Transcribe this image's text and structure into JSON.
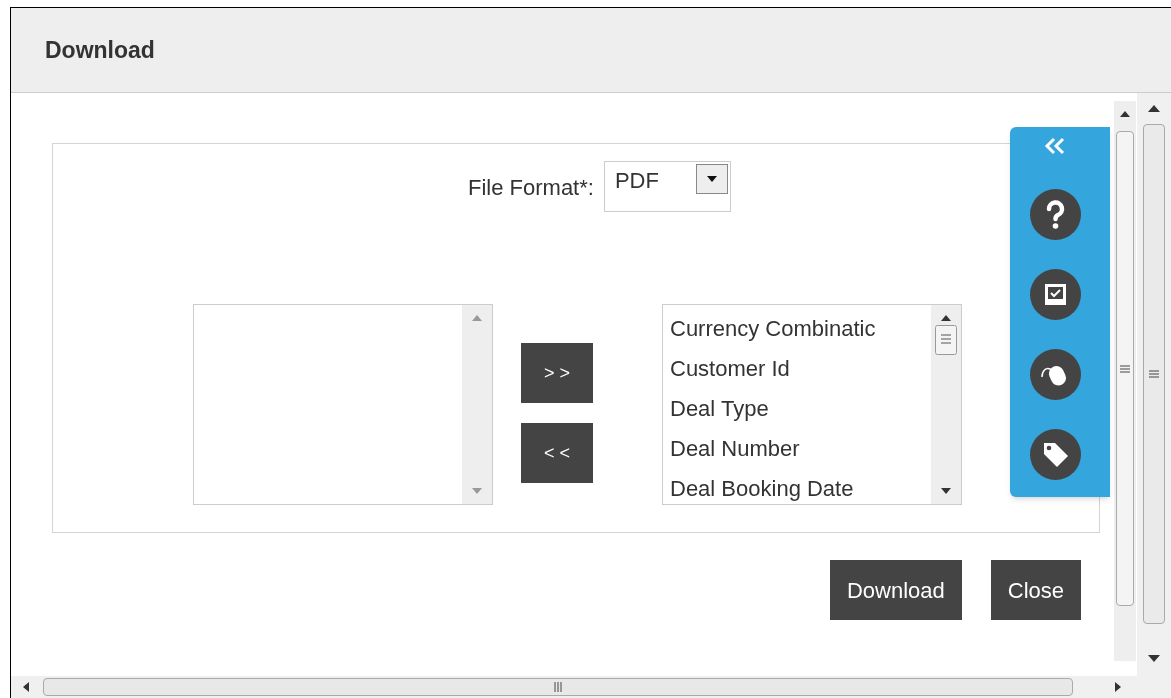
{
  "window": {
    "title": "Download"
  },
  "file_format": {
    "label": "File Format*:",
    "value": "PDF"
  },
  "move_buttons": [
    "> >",
    "< <"
  ],
  "selected_fields": [
    "Currency Combinatic",
    "Customer Id",
    "Deal Type",
    "Deal Number",
    "Deal Booking Date"
  ],
  "buttons": [
    "Download",
    "Close"
  ]
}
